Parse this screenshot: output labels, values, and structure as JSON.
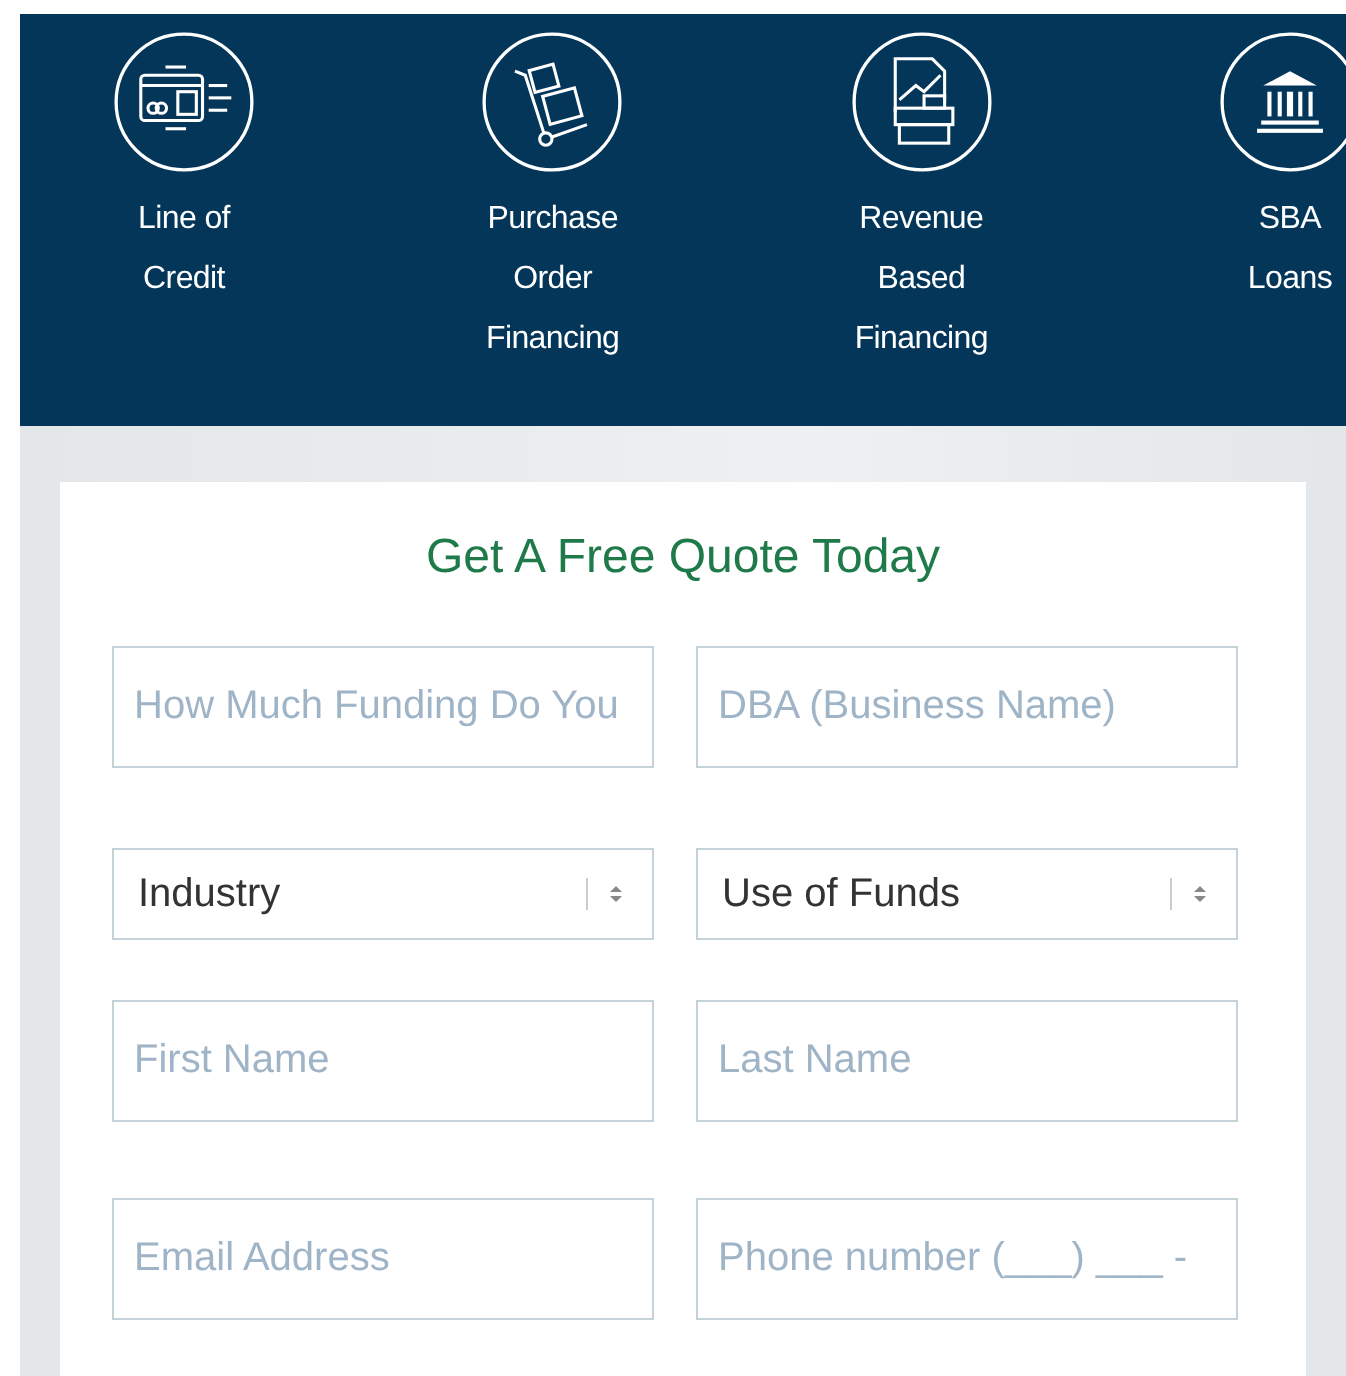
{
  "products": [
    {
      "kind": "card",
      "label_lines": [
        "Line of",
        "Credit"
      ]
    },
    {
      "kind": "cart",
      "label_lines": [
        "Purchase",
        "Order",
        "Financing"
      ]
    },
    {
      "kind": "register",
      "label_lines": [
        "Revenue",
        "Based",
        "Financing"
      ]
    },
    {
      "kind": "bank",
      "label_lines": [
        "SBA",
        "Loans"
      ]
    }
  ],
  "form": {
    "title": "Get A Free Quote Today",
    "rows": [
      [
        {
          "kind": "text",
          "placeholder": "How Much Funding Do You"
        },
        {
          "kind": "text",
          "placeholder": "DBA (Business Name)"
        }
      ],
      [
        {
          "kind": "select",
          "value": "Industry"
        },
        {
          "kind": "select",
          "value": "Use of Funds"
        }
      ],
      [
        {
          "kind": "text",
          "placeholder": "First Name"
        },
        {
          "kind": "text",
          "placeholder": "Last Name"
        }
      ],
      [
        {
          "kind": "text",
          "placeholder": "Email Address"
        },
        {
          "kind": "text",
          "placeholder": "Phone number (___) ___ -"
        }
      ]
    ]
  }
}
